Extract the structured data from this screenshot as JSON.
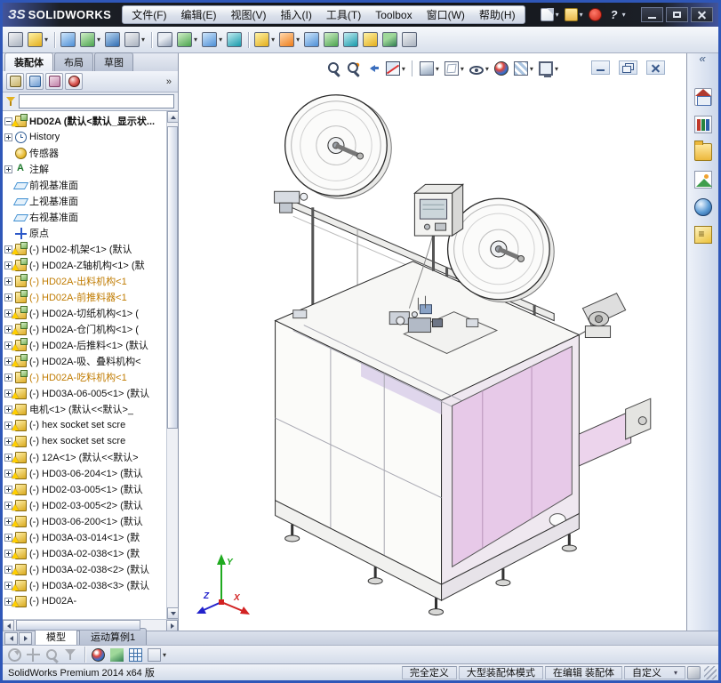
{
  "titlebar": {
    "logo_mark": "ЗS",
    "logo_text": "SOLIDWORKS",
    "menus": [
      {
        "name": "menu-file",
        "label": "文件(F)"
      },
      {
        "name": "menu-edit",
        "label": "编辑(E)"
      },
      {
        "name": "menu-view",
        "label": "视图(V)"
      },
      {
        "name": "menu-insert",
        "label": "插入(I)"
      },
      {
        "name": "menu-tools",
        "label": "工具(T)"
      },
      {
        "name": "menu-toolbox",
        "label": "Toolbox"
      },
      {
        "name": "menu-window",
        "label": "窗口(W)"
      },
      {
        "name": "menu-help",
        "label": "帮助(H)"
      }
    ],
    "quick_icons": [
      {
        "name": "new-document-icon",
        "g": "qi-new",
        "b": "drop",
        "inter": "true"
      },
      {
        "name": "open-document-icon",
        "g": "qi-open",
        "b": "drop",
        "inter": "true"
      },
      {
        "name": "macro-record-icon",
        "g": "qi-rec",
        "inter": "true"
      },
      {
        "name": "help-icon",
        "g": "qi-help",
        "b": "drop",
        "inter": "true"
      }
    ]
  },
  "toolbar": {
    "icons": [
      {
        "name": "edit-component-icon",
        "g": "pal-a",
        "inter": "true"
      },
      {
        "name": "insert-components-icon",
        "g": "pal-b",
        "b": "drop",
        "inter": "true"
      },
      {
        "name": "toolbar-separator",
        "g": "sepg",
        "b": "sep",
        "inter": "false"
      },
      {
        "name": "mate-icon",
        "g": "pal-c",
        "inter": "true"
      },
      {
        "name": "linear-component-pattern-icon",
        "g": "pal-d",
        "b": "drop",
        "inter": "true"
      },
      {
        "name": "smart-fasteners-icon",
        "g": "pal-c2",
        "inter": "true"
      },
      {
        "name": "move-component-icon",
        "g": "pal-a",
        "b": "drop",
        "inter": "true"
      },
      {
        "name": "toolbar-separator",
        "g": "sepg",
        "b": "sep",
        "inter": "false"
      },
      {
        "name": "show-hidden-components-icon",
        "g": "pal-a2",
        "inter": "true"
      },
      {
        "name": "assembly-features-icon",
        "g": "pal-d",
        "b": "drop",
        "inter": "true"
      },
      {
        "name": "reference-geometry-icon",
        "g": "pal-c",
        "b": "drop",
        "inter": "true"
      },
      {
        "name": "new-motion-study-icon",
        "g": "pal-e",
        "inter": "true"
      },
      {
        "name": "toolbar-separator",
        "g": "sepg",
        "b": "sep",
        "inter": "false"
      },
      {
        "name": "bill-of-materials-icon",
        "g": "pal-b",
        "b": "drop",
        "inter": "true"
      },
      {
        "name": "exploded-view-icon",
        "g": "pal-f",
        "b": "drop",
        "inter": "true"
      },
      {
        "name": "explode-line-sketch-icon",
        "g": "pal-c",
        "inter": "true"
      },
      {
        "name": "interference-detection-icon",
        "g": "pal-d",
        "inter": "true"
      },
      {
        "name": "clearance-verification-icon",
        "g": "pal-e",
        "inter": "true"
      },
      {
        "name": "hole-alignment-icon",
        "g": "pal-b",
        "inter": "true"
      },
      {
        "name": "assembly-visualization-icon",
        "g": "pal-d2",
        "inter": "true"
      },
      {
        "name": "performance-evaluation-icon",
        "g": "pal-a",
        "inter": "true"
      }
    ]
  },
  "command_tabs": {
    "items": [
      {
        "name": "tab-assembly",
        "label": "装配体",
        "cls": "active"
      },
      {
        "name": "tab-layout",
        "label": "布局",
        "cls": ""
      },
      {
        "name": "tab-sketch",
        "label": "草图",
        "cls": ""
      }
    ]
  },
  "feature_panel": {
    "header_icons": [
      {
        "name": "featuremanager-tab-icon",
        "g": "ph-fm",
        "inter": "true"
      },
      {
        "name": "propertymanager-tab-icon",
        "g": "ph-pm",
        "inter": "true"
      },
      {
        "name": "configurationmanager-tab-icon",
        "g": "ph-cm",
        "inter": "true"
      },
      {
        "name": "displaymanager-tab-icon",
        "g": "ph-dm",
        "inter": "true"
      }
    ],
    "overflow": "»",
    "tree": {
      "items": [
        {
          "label": "HD02A (默认<默认_显示状...",
          "ico": "i-asmtop",
          "wm": "on",
          "plus": "minus",
          "lcls": "b"
        },
        {
          "label": "History",
          "ico": "i-hist",
          "plus": "on"
        },
        {
          "label": "传感器",
          "ico": "i-sens",
          "plus": "off"
        },
        {
          "label": "注解",
          "ico": "i-ann",
          "plus": "on"
        },
        {
          "label": "前视基准面",
          "ico": "i-plane",
          "plus": "off"
        },
        {
          "label": "上视基准面",
          "ico": "i-plane",
          "plus": "off"
        },
        {
          "label": "右视基准面",
          "ico": "i-plane",
          "plus": "off"
        },
        {
          "label": "原点",
          "ico": "i-origin",
          "plus": "off"
        },
        {
          "label": "(-) HD02-机架<1> (默认",
          "ico": "i-asm",
          "wm": "on",
          "plus": "on"
        },
        {
          "label": "(-) HD02A-Z轴机构<1> (默",
          "ico": "i-asm",
          "wm": "on",
          "plus": "on"
        },
        {
          "label": "(-) HD02A-出料机构<1",
          "ico": "i-asm",
          "plus": "on",
          "lcls": "orange"
        },
        {
          "label": "(-) HD02A-前推料器<1",
          "ico": "i-asm",
          "plus": "on",
          "lcls": "orange"
        },
        {
          "label": "(-) HD02A-切纸机构<1> (",
          "ico": "i-asm",
          "wm": "on",
          "plus": "on"
        },
        {
          "label": "(-) HD02A-仓门机构<1> (",
          "ico": "i-asm",
          "wm": "on",
          "plus": "on"
        },
        {
          "label": "(-) HD02A-后推料<1> (默认",
          "ico": "i-asm",
          "wm": "on",
          "plus": "on"
        },
        {
          "label": "(-) HD02A-吸、叠料机构<",
          "ico": "i-asm",
          "wm": "on",
          "plus": "on"
        },
        {
          "label": "(-) HD02A-吃料机构<1",
          "ico": "i-asm",
          "plus": "on",
          "lcls": "orange"
        },
        {
          "label": "(-) HD03A-06-005<1> (默认",
          "ico": "i-part",
          "wm": "on",
          "plus": "on"
        },
        {
          "label": "电机<1> (默认<<默认>_",
          "ico": "i-part",
          "wm": "on",
          "plus": "on"
        },
        {
          "label": "(-) hex socket set scre",
          "ico": "i-part",
          "wm": "on",
          "plus": "on"
        },
        {
          "label": "(-) hex socket set scre",
          "ico": "i-part",
          "wm": "on",
          "plus": "on"
        },
        {
          "label": "(-) 12A<1> (默认<<默认>",
          "ico": "i-part",
          "wm": "on",
          "plus": "on"
        },
        {
          "label": "(-) HD03-06-204<1> (默认",
          "ico": "i-part",
          "wm": "on",
          "plus": "on"
        },
        {
          "label": "(-) HD02-03-005<1> (默认",
          "ico": "i-part",
          "wm": "on",
          "plus": "on"
        },
        {
          "label": "(-) HD02-03-005<2> (默认",
          "ico": "i-part",
          "wm": "on",
          "plus": "on"
        },
        {
          "label": "(-) HD03-06-200<1> (默认",
          "ico": "i-part",
          "wm": "on",
          "plus": "on"
        },
        {
          "label": "(-) HD03A-03-014<1> (默",
          "ico": "i-part",
          "wm": "on",
          "plus": "on"
        },
        {
          "label": "(-) HD03A-02-038<1> (默",
          "ico": "i-part",
          "wm": "on",
          "plus": "on"
        },
        {
          "label": "(-) HD03A-02-038<2> (默认",
          "ico": "i-part",
          "wm": "on",
          "plus": "on"
        },
        {
          "label": "(-) HD03A-02-038<3> (默认",
          "ico": "i-part",
          "wm": "on",
          "plus": "on"
        },
        {
          "label": "(-) HD02A-",
          "ico": "i-part",
          "wm": "on",
          "plus": "on"
        }
      ]
    }
  },
  "viewport": {
    "hud": [
      {
        "name": "zoom-to-fit-icon",
        "g": "h-zoomfit",
        "inter": "true"
      },
      {
        "name": "zoom-to-area-icon",
        "g": "h-zoomarea",
        "inter": "true"
      },
      {
        "name": "previous-view-icon",
        "g": "h-prev",
        "inter": "true"
      },
      {
        "name": "section-view-icon",
        "g": "h-section",
        "b": "drop",
        "inter": "true"
      },
      {
        "name": "hud-separator",
        "g": "sepg",
        "b": "sep",
        "inter": "false"
      },
      {
        "name": "view-orientation-icon",
        "g": "h-cube",
        "b": "drop",
        "inter": "true"
      },
      {
        "name": "display-style-icon",
        "g": "h-display",
        "b": "drop",
        "inter": "true"
      },
      {
        "name": "hide-show-items-icon",
        "g": "h-eye",
        "b": "drop",
        "inter": "true"
      },
      {
        "name": "edit-appearance-icon",
        "g": "h-ball",
        "inter": "true"
      },
      {
        "name": "apply-scene-icon",
        "g": "h-scene",
        "b": "drop",
        "inter": "true"
      },
      {
        "name": "view-settings-icon",
        "g": "h-settings",
        "b": "drop",
        "inter": "true"
      }
    ],
    "doc_controls": [
      {
        "name": "document-minimize-button",
        "g": "dc-min",
        "inter": "true"
      },
      {
        "name": "document-restore-button",
        "g": "dc-rest",
        "inter": "true"
      },
      {
        "name": "document-close-button",
        "g": "dc-close",
        "inter": "true"
      }
    ],
    "triad": {
      "x": "X",
      "y": "Y",
      "z": "Z"
    }
  },
  "task_pane": {
    "icons": [
      {
        "name": "collapse-task-pane-icon",
        "g": "tp-collapse",
        "inter": "true"
      },
      {
        "name": "solidworks-resources-icon",
        "g": "tp-home",
        "inter": "true"
      },
      {
        "name": "design-library-icon",
        "g": "tp-library",
        "inter": "true"
      },
      {
        "name": "file-explorer-icon",
        "g": "tp-explorer",
        "inter": "true"
      },
      {
        "name": "view-palette-icon",
        "g": "tp-palette",
        "inter": "true"
      },
      {
        "name": "appearances-scenes-icon",
        "g": "tp-appearance",
        "inter": "true"
      },
      {
        "name": "custom-properties-icon",
        "g": "tp-props",
        "inter": "true"
      }
    ]
  },
  "bottom_tabs": {
    "items": [
      {
        "name": "tab-model",
        "label": "模型",
        "cls": "active"
      },
      {
        "name": "tab-motion-study-1",
        "label": "运动算例1",
        "cls": ""
      }
    ]
  },
  "bottom_toolbar": {
    "icons": [
      {
        "name": "rotate-view-icon",
        "g": "bb-rotate dis",
        "inter": "true"
      },
      {
        "name": "pan-view-icon",
        "g": "bb-pan dis",
        "inter": "true"
      },
      {
        "name": "zoom-in-out-icon",
        "g": "bb-zoom dis",
        "inter": "true"
      },
      {
        "name": "selection-filter-icon",
        "g": "bb-filter dis",
        "inter": "true"
      },
      {
        "name": "toolbar-separator",
        "g": "sepg",
        "b": "sep",
        "inter": "false"
      },
      {
        "name": "edit-appearance-icon",
        "g": "h-ball",
        "inter": "true"
      },
      {
        "name": "assembly-visualization-icon",
        "g": "pal-d2",
        "inter": "true"
      },
      {
        "name": "grid-table-icon",
        "g": "bb-grid",
        "inter": "true"
      },
      {
        "name": "toolbar-options-icon",
        "g": "bb-more",
        "b": "drop",
        "inter": "true"
      }
    ]
  },
  "statusbar": {
    "left": "SolidWorks Premium 2014 x64 版",
    "fields": [
      {
        "name": "status-fully-defined",
        "label": "完全定义"
      },
      {
        "name": "status-large-assembly-mode",
        "label": "大型装配体模式"
      },
      {
        "name": "status-editing-assembly",
        "label": "在编辑 装配体"
      }
    ],
    "custom": "自定义"
  },
  "colors": {
    "window_border": "#2f57b8",
    "warning": "#ffcf00",
    "tree_highlight": "#c07b00",
    "model_pink": "#e7c9e8"
  }
}
